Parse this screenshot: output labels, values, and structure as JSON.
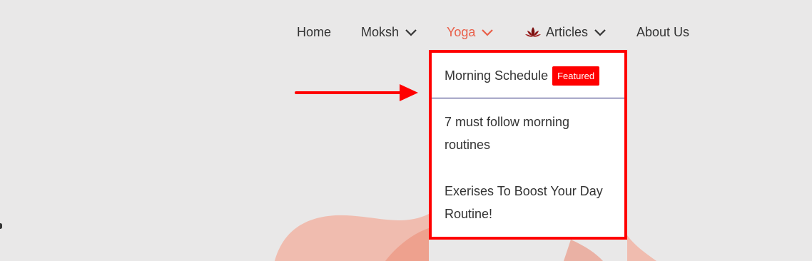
{
  "nav": {
    "items": [
      {
        "label": "Home",
        "has_dropdown": false,
        "active": false
      },
      {
        "label": "Moksh",
        "has_dropdown": true,
        "active": false
      },
      {
        "label": "Yoga",
        "has_dropdown": true,
        "active": true
      },
      {
        "label": "Articles",
        "has_dropdown": true,
        "active": false,
        "icon": "lotus-icon"
      },
      {
        "label": "About Us",
        "has_dropdown": false,
        "active": false
      }
    ]
  },
  "dropdown": {
    "items": [
      {
        "label": "Morning Schedule",
        "badge": "Featured"
      },
      {
        "label": "7 must follow morning routines"
      },
      {
        "label": "Exerises To Boost Your Day Routine!"
      }
    ]
  },
  "colors": {
    "background": "#e9e8e8",
    "accent": "#e9604a",
    "highlight": "#ff0000",
    "text": "#333333",
    "divider": "#1a1a6e"
  },
  "icons": {
    "chevron": "chevron-down-icon",
    "articles": "lotus-icon",
    "annotation": "red-arrow-icon"
  }
}
